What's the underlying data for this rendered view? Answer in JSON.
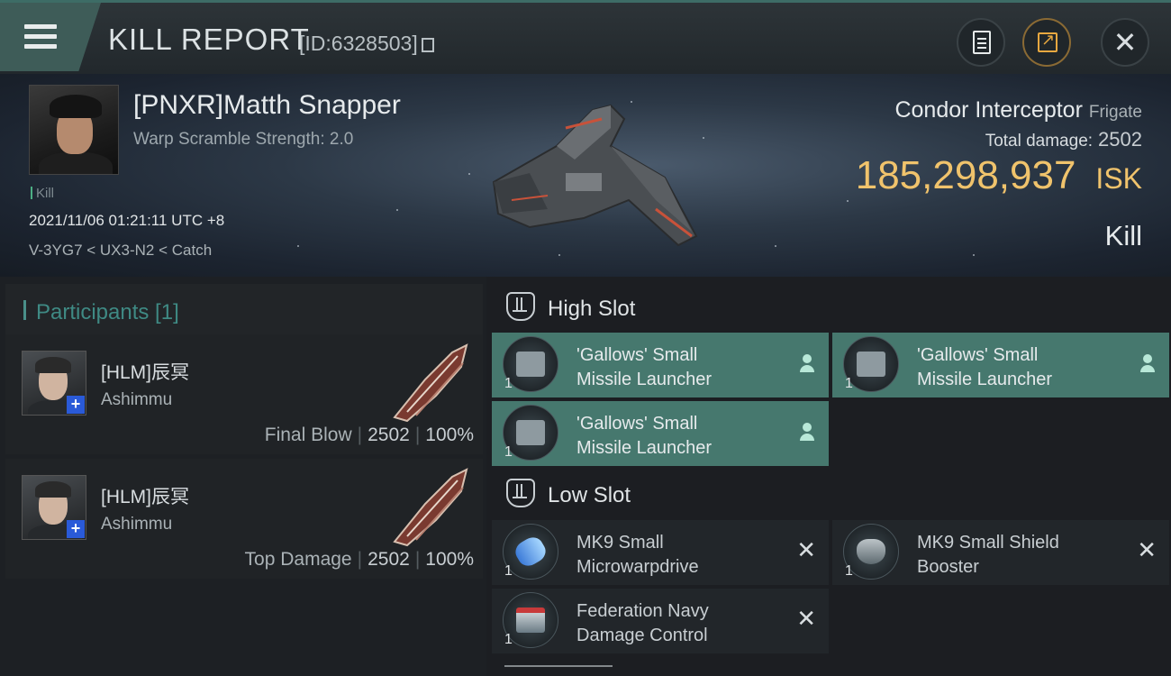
{
  "header": {
    "title": "KILL REPORT",
    "report_id": "[ID:6328503]",
    "icons": [
      "menu-icon",
      "copy-icon",
      "clipboard-icon",
      "share-icon",
      "close-icon"
    ]
  },
  "victim": {
    "pilot_name": "[PNXR]Matth Snapper",
    "warp_scramble": "Warp Scramble Strength: 2.0",
    "tag": "Kill",
    "datetime": "2021/11/06 01:21:11 UTC +8",
    "location": "V-3YG7 < UX3-N2 < Catch",
    "ship_name": "Condor Interceptor",
    "ship_class": "Frigate",
    "total_damage_label": "Total damage:",
    "total_damage": "2502",
    "isk_value": "185,298,937",
    "isk_unit": "ISK",
    "result": "Kill"
  },
  "participants": {
    "heading": "Participants [1]",
    "rows": [
      {
        "name": "[HLM]辰冥",
        "ship": "Ashimmu",
        "role": "Final Blow",
        "damage": "2502",
        "percent": "100%"
      },
      {
        "name": "[HLM]辰冥",
        "ship": "Ashimmu",
        "role": "Top Damage",
        "damage": "2502",
        "percent": "100%"
      }
    ]
  },
  "slots": {
    "high": {
      "label": "High Slot",
      "modules": [
        {
          "line1": "'Gallows' Small",
          "line2": "Missile Launcher",
          "qty": "1",
          "state": "fitted"
        },
        {
          "line1": "'Gallows' Small",
          "line2": "Missile Launcher",
          "qty": "1",
          "state": "fitted"
        },
        {
          "line1": "'Gallows' Small",
          "line2": "Missile Launcher",
          "qty": "1",
          "state": "fitted"
        }
      ]
    },
    "low": {
      "label": "Low Slot",
      "modules": [
        {
          "line1": "MK9 Small",
          "line2": "Microwarpdrive",
          "qty": "1",
          "state": "destroyed"
        },
        {
          "line1": "MK9 Small Shield",
          "line2": "Booster",
          "qty": "1",
          "state": "destroyed"
        },
        {
          "line1": "Federation Navy",
          "line2": "Damage Control",
          "qty": "1",
          "state": "destroyed"
        }
      ]
    },
    "x_mark": "✕"
  },
  "colors": {
    "accent_teal": "#46786e",
    "isk_gold": "#f0c36c",
    "participants_heading": "#3f8a84"
  }
}
